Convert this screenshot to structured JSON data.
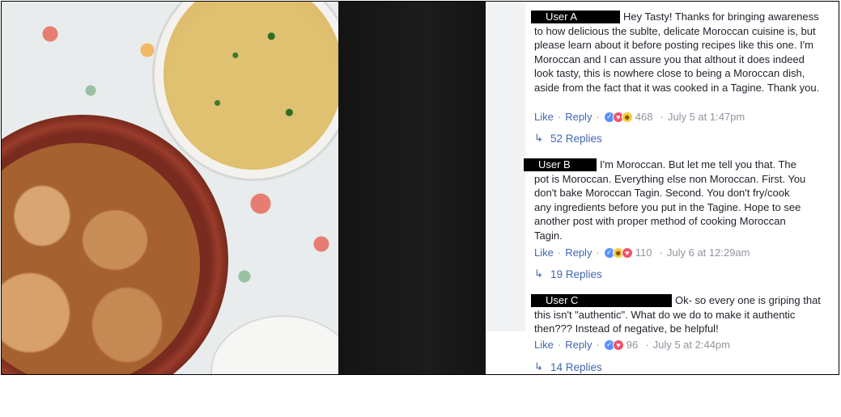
{
  "comments": [
    {
      "author": "User A",
      "text": "Hey Tasty! Thanks for bringing awareness to how delicious the sublte, delicate Moroccan cuisine is, but please learn about it before posting recipes like this one. I'm Moroccan and I can assure you that althout it does indeed look tasty, this is nowhere close to being a Moroccan dish, aside from the fact that it was cooked in a Tagine. Thank you.",
      "like_label": "Like",
      "reply_label": "Reply",
      "reaction_icons": [
        "like-icon",
        "love-icon",
        "haha-icon"
      ],
      "reaction_count": "468",
      "timestamp": "July 5 at 1:47pm",
      "replies_label": "52 Replies"
    },
    {
      "author": "User B",
      "text": "I'm Moroccan. But let me tell you that. The pot is Moroccan. Everything else non Moroccan. First. You don't bake Moroccan Tagin. Second. You don't fry/cook any ingredients before you put in the Tagine. Hope to see another post with proper method of cooking Moroccan Tagin.",
      "like_label": "Like",
      "reply_label": "Reply",
      "reaction_icons": [
        "like-icon",
        "haha-icon",
        "love-icon"
      ],
      "reaction_count": "110",
      "timestamp": "July 6 at 12:29am",
      "replies_label": "19 Replies"
    },
    {
      "author": "User C",
      "text": "Ok- so every one is griping that this isn't \"authentic\". What do we do to make it authentic then??? Instead of negative, be helpful!",
      "like_label": "Like",
      "reply_label": "Reply",
      "reaction_icons": [
        "like-icon",
        "love-icon"
      ],
      "reaction_count": "96",
      "timestamp": "July 5 at 2:44pm",
      "replies_label": "14 Replies"
    }
  ],
  "colors": {
    "link": "#4267b2",
    "meta": "#90949c",
    "text": "#1d2129",
    "like_reaction": "#5890ff",
    "love_reaction": "#f25268",
    "haha_reaction": "#f7c93d"
  }
}
